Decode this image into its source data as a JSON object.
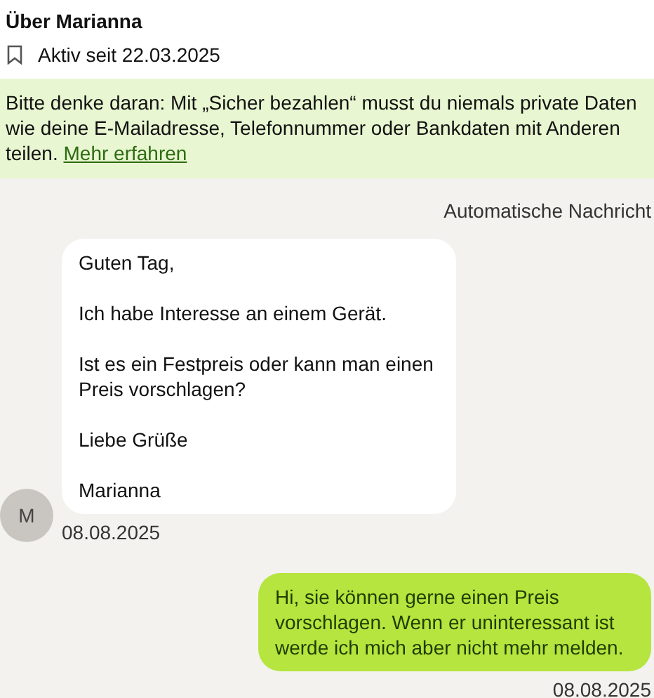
{
  "header": {
    "title": "Über Marianna",
    "active_since": "Aktiv seit 22.03.2025"
  },
  "notice": {
    "text": "Bitte denke daran: Mit „Sicher bezahlen“ musst du niemals private Daten wie deine E-Mailadresse, Telefonnummer oder Bankdaten mit Anderen teilen.",
    "link": "Mehr erfahren"
  },
  "chat": {
    "automatic_label": "Automatische Nachricht",
    "messages": [
      {
        "kind": "incoming",
        "avatar": "M",
        "paragraphs": [
          "Guten Tag,",
          "Ich habe Interesse an einem Gerät.",
          "Ist es ein Festpreis oder kann man einen Preis vorschlagen?",
          "Liebe Grüße",
          "Marianna"
        ],
        "date": "08.08.2025"
      },
      {
        "kind": "outgoing",
        "paragraphs": [
          "Hi, sie können gerne einen Preis vorschlagen. Wenn er uninteressant ist werde ich mich aber nicht mehr melden."
        ],
        "date": "08.08.2025"
      }
    ]
  }
}
